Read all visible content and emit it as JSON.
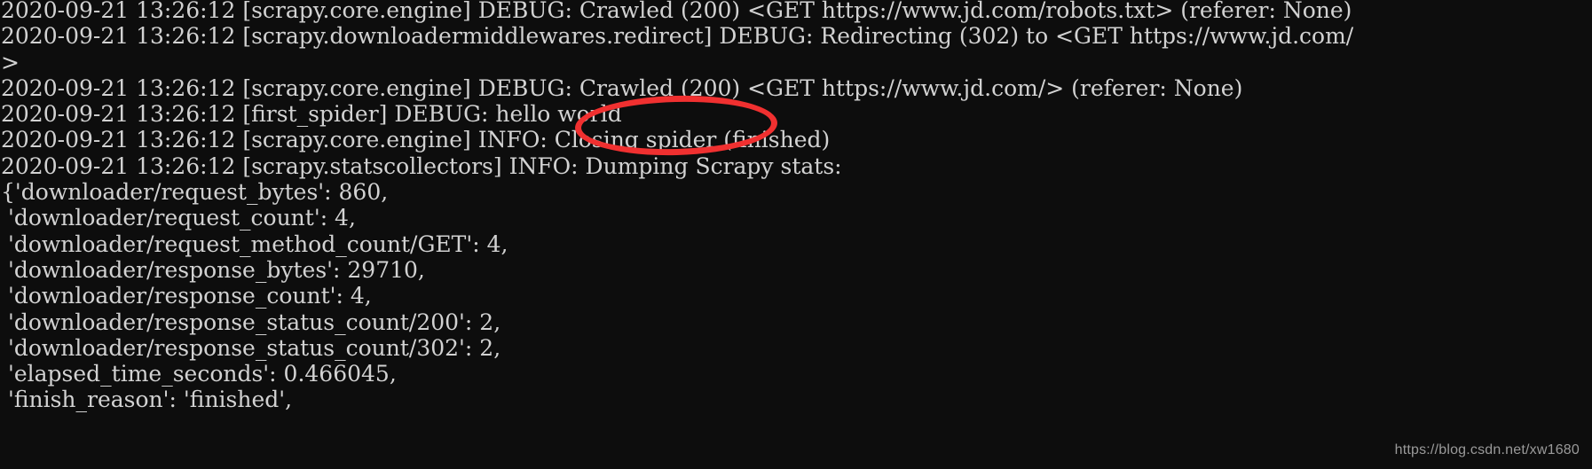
{
  "terminal": {
    "background_color": "#0d0d0d",
    "text_color": "#d2d2d2",
    "lines": [
      "2020-09-21 13:26:12 [scrapy.core.engine] DEBUG: Crawled (200) <GET https://www.jd.com/robots.txt> (referer: None)",
      "2020-09-21 13:26:12 [scrapy.downloadermiddlewares.redirect] DEBUG: Redirecting (302) to <GET https://www.jd.com/",
      ">",
      "2020-09-21 13:26:12 [scrapy.core.engine] DEBUG: Crawled (200) <GET https://www.jd.com/> (referer: None)",
      "2020-09-21 13:26:12 [first_spider] DEBUG: hello world",
      "2020-09-21 13:26:12 [scrapy.core.engine] INFO: Closing spider (finished)",
      "2020-09-21 13:26:12 [scrapy.statscollectors] INFO: Dumping Scrapy stats:",
      "{'downloader/request_bytes': 860,",
      " 'downloader/request_count': 4,",
      " 'downloader/request_method_count/GET': 4,",
      " 'downloader/response_bytes': 29710,",
      " 'downloader/response_count': 4,",
      " 'downloader/response_status_count/200': 2,",
      " 'downloader/response_status_count/302': 2,",
      " 'elapsed_time_seconds': 0.466045,",
      " 'finish_reason': 'finished',"
    ]
  },
  "annotation": {
    "shape": "ellipse",
    "color": "#f03030",
    "highlighted_text": "hello world"
  },
  "watermark": {
    "text": "https://blog.csdn.net/xw1680",
    "color": "#9a9a9a"
  }
}
